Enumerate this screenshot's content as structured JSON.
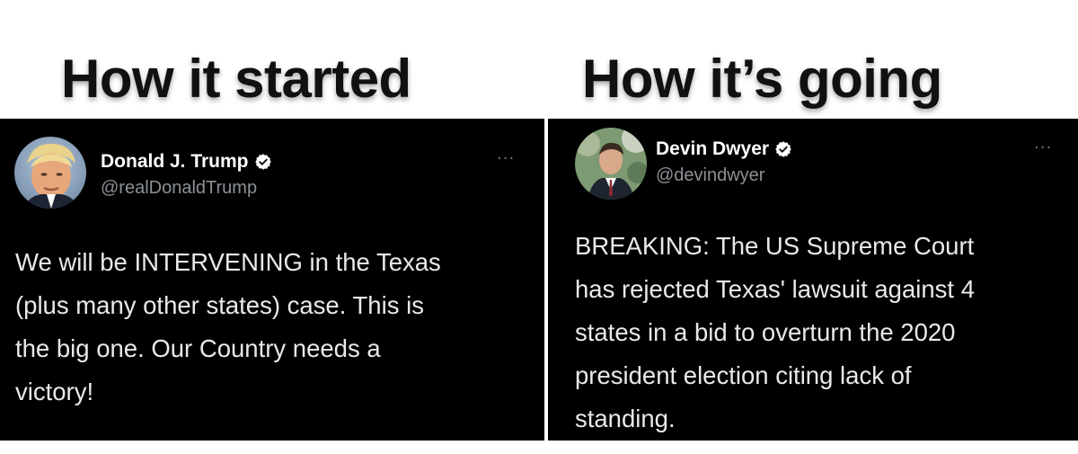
{
  "captions": {
    "left": "How it started",
    "right": "How it’s going"
  },
  "tweets": [
    {
      "name": "Donald J. Trump",
      "handle": "@realDonaldTrump",
      "more": "···",
      "text": "We will be INTERVENING in the Texas\n(plus many other states) case. This is\nthe big one. Our Country needs a\nvictory!"
    },
    {
      "name": "Devin Dwyer",
      "handle": "@devindwyer",
      "more": "···",
      "text": "BREAKING: The US Supreme Court\nhas rejected Texas' lawsuit against 4\nstates in a bid to overturn the 2020\npresident election citing lack of\nstanding."
    }
  ],
  "icons": {
    "verified": "verified-badge-icon",
    "more": "more-options-icon"
  },
  "colors": {
    "panel_bg": "#000000",
    "text": "#e7e9ea",
    "handle": "#8b9095",
    "verified_bg": "#ffffff"
  }
}
